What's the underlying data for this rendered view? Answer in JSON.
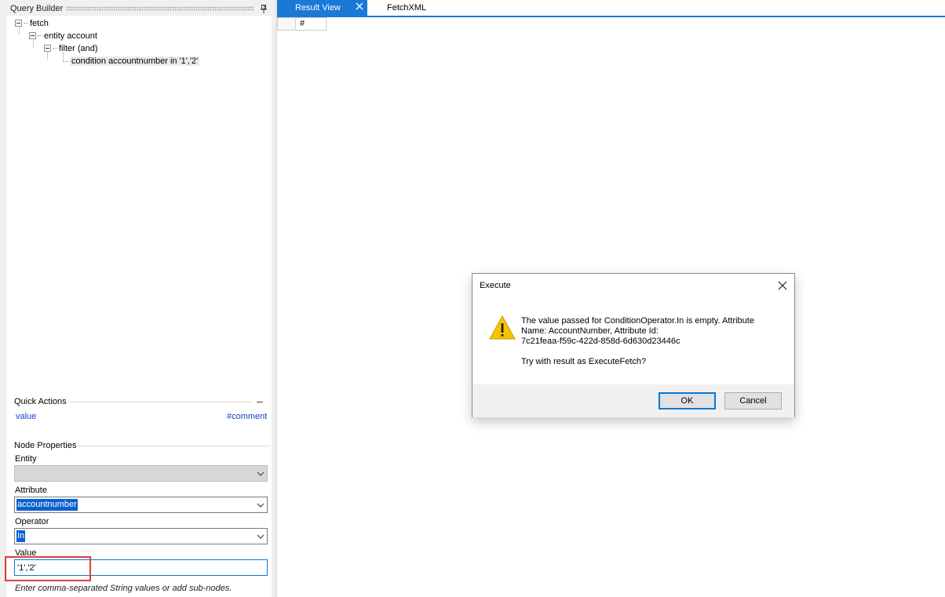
{
  "query_builder": {
    "title": "Query Builder",
    "tree": {
      "root": "fetch",
      "entity": "entity account",
      "filter": "filter (and)",
      "condition": "condition accountnumber in '1','2'"
    }
  },
  "quick_actions": {
    "title": "Quick Actions",
    "left_link": "value",
    "right_link": "#comment"
  },
  "node_properties": {
    "title": "Node Properties",
    "entity_label": "Entity",
    "entity_value": "",
    "attribute_label": "Attribute",
    "attribute_value": "accountnumber",
    "operator_label": "Operator",
    "operator_value": "In",
    "value_label": "Value",
    "value_value": "'1','2'",
    "hint": "Enter comma-separated String values or add sub-nodes."
  },
  "tabs": {
    "result_view": "Result View",
    "fetchxml": "FetchXML"
  },
  "grid": {
    "column_hash": "#"
  },
  "dialog": {
    "title": "Execute",
    "message_line1": "The value passed for ConditionOperator.In is empty. Attribute",
    "message_line2": "Name: AccountNumber, Attribute Id:",
    "message_line3": "7c21feaa-f59c-422d-858d-6d630d23446c",
    "question": "Try with result as ExecuteFetch?",
    "ok_label": "OK",
    "cancel_label": "Cancel"
  },
  "colors": {
    "accent": "#1a78d7",
    "highlight_border": "#d94040",
    "link": "#1a3ccc"
  },
  "icons": {
    "pin": "pin-icon",
    "tab_close": "close-icon",
    "dialog_close": "close-icon",
    "warning": "warning-icon",
    "dropdown": "chevron-down-icon"
  }
}
